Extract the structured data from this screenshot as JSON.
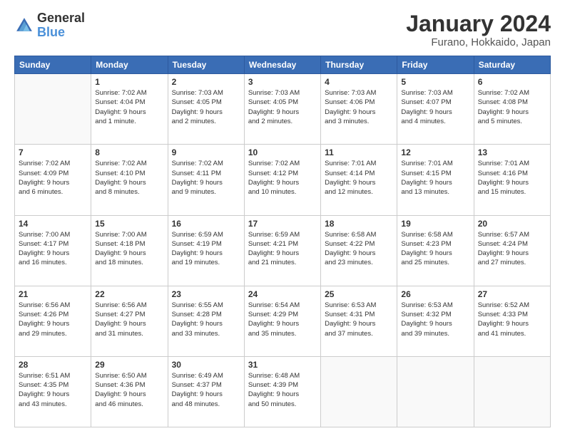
{
  "logo": {
    "line1": "General",
    "line2": "Blue"
  },
  "title": "January 2024",
  "subtitle": "Furano, Hokkaido, Japan",
  "days_of_week": [
    "Sunday",
    "Monday",
    "Tuesday",
    "Wednesday",
    "Thursday",
    "Friday",
    "Saturday"
  ],
  "weeks": [
    [
      {
        "day": "",
        "info": ""
      },
      {
        "day": "1",
        "info": "Sunrise: 7:02 AM\nSunset: 4:04 PM\nDaylight: 9 hours\nand 1 minute."
      },
      {
        "day": "2",
        "info": "Sunrise: 7:03 AM\nSunset: 4:05 PM\nDaylight: 9 hours\nand 2 minutes."
      },
      {
        "day": "3",
        "info": "Sunrise: 7:03 AM\nSunset: 4:05 PM\nDaylight: 9 hours\nand 2 minutes."
      },
      {
        "day": "4",
        "info": "Sunrise: 7:03 AM\nSunset: 4:06 PM\nDaylight: 9 hours\nand 3 minutes."
      },
      {
        "day": "5",
        "info": "Sunrise: 7:03 AM\nSunset: 4:07 PM\nDaylight: 9 hours\nand 4 minutes."
      },
      {
        "day": "6",
        "info": "Sunrise: 7:02 AM\nSunset: 4:08 PM\nDaylight: 9 hours\nand 5 minutes."
      }
    ],
    [
      {
        "day": "7",
        "info": "Sunrise: 7:02 AM\nSunset: 4:09 PM\nDaylight: 9 hours\nand 6 minutes."
      },
      {
        "day": "8",
        "info": "Sunrise: 7:02 AM\nSunset: 4:10 PM\nDaylight: 9 hours\nand 8 minutes."
      },
      {
        "day": "9",
        "info": "Sunrise: 7:02 AM\nSunset: 4:11 PM\nDaylight: 9 hours\nand 9 minutes."
      },
      {
        "day": "10",
        "info": "Sunrise: 7:02 AM\nSunset: 4:12 PM\nDaylight: 9 hours\nand 10 minutes."
      },
      {
        "day": "11",
        "info": "Sunrise: 7:01 AM\nSunset: 4:14 PM\nDaylight: 9 hours\nand 12 minutes."
      },
      {
        "day": "12",
        "info": "Sunrise: 7:01 AM\nSunset: 4:15 PM\nDaylight: 9 hours\nand 13 minutes."
      },
      {
        "day": "13",
        "info": "Sunrise: 7:01 AM\nSunset: 4:16 PM\nDaylight: 9 hours\nand 15 minutes."
      }
    ],
    [
      {
        "day": "14",
        "info": "Sunrise: 7:00 AM\nSunset: 4:17 PM\nDaylight: 9 hours\nand 16 minutes."
      },
      {
        "day": "15",
        "info": "Sunrise: 7:00 AM\nSunset: 4:18 PM\nDaylight: 9 hours\nand 18 minutes."
      },
      {
        "day": "16",
        "info": "Sunrise: 6:59 AM\nSunset: 4:19 PM\nDaylight: 9 hours\nand 19 minutes."
      },
      {
        "day": "17",
        "info": "Sunrise: 6:59 AM\nSunset: 4:21 PM\nDaylight: 9 hours\nand 21 minutes."
      },
      {
        "day": "18",
        "info": "Sunrise: 6:58 AM\nSunset: 4:22 PM\nDaylight: 9 hours\nand 23 minutes."
      },
      {
        "day": "19",
        "info": "Sunrise: 6:58 AM\nSunset: 4:23 PM\nDaylight: 9 hours\nand 25 minutes."
      },
      {
        "day": "20",
        "info": "Sunrise: 6:57 AM\nSunset: 4:24 PM\nDaylight: 9 hours\nand 27 minutes."
      }
    ],
    [
      {
        "day": "21",
        "info": "Sunrise: 6:56 AM\nSunset: 4:26 PM\nDaylight: 9 hours\nand 29 minutes."
      },
      {
        "day": "22",
        "info": "Sunrise: 6:56 AM\nSunset: 4:27 PM\nDaylight: 9 hours\nand 31 minutes."
      },
      {
        "day": "23",
        "info": "Sunrise: 6:55 AM\nSunset: 4:28 PM\nDaylight: 9 hours\nand 33 minutes."
      },
      {
        "day": "24",
        "info": "Sunrise: 6:54 AM\nSunset: 4:29 PM\nDaylight: 9 hours\nand 35 minutes."
      },
      {
        "day": "25",
        "info": "Sunrise: 6:53 AM\nSunset: 4:31 PM\nDaylight: 9 hours\nand 37 minutes."
      },
      {
        "day": "26",
        "info": "Sunrise: 6:53 AM\nSunset: 4:32 PM\nDaylight: 9 hours\nand 39 minutes."
      },
      {
        "day": "27",
        "info": "Sunrise: 6:52 AM\nSunset: 4:33 PM\nDaylight: 9 hours\nand 41 minutes."
      }
    ],
    [
      {
        "day": "28",
        "info": "Sunrise: 6:51 AM\nSunset: 4:35 PM\nDaylight: 9 hours\nand 43 minutes."
      },
      {
        "day": "29",
        "info": "Sunrise: 6:50 AM\nSunset: 4:36 PM\nDaylight: 9 hours\nand 46 minutes."
      },
      {
        "day": "30",
        "info": "Sunrise: 6:49 AM\nSunset: 4:37 PM\nDaylight: 9 hours\nand 48 minutes."
      },
      {
        "day": "31",
        "info": "Sunrise: 6:48 AM\nSunset: 4:39 PM\nDaylight: 9 hours\nand 50 minutes."
      },
      {
        "day": "",
        "info": ""
      },
      {
        "day": "",
        "info": ""
      },
      {
        "day": "",
        "info": ""
      }
    ]
  ]
}
